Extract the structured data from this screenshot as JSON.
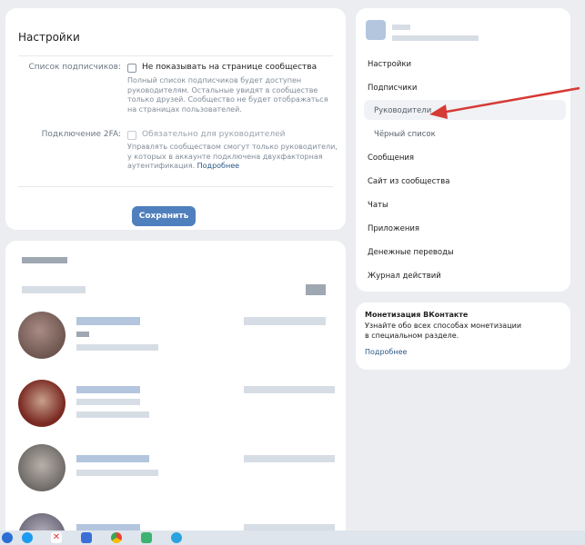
{
  "settings": {
    "title": "Настройки",
    "subscribers_label": "Список подписчиков:",
    "subscribers_checkbox": "Не показывать на странице сообщества",
    "subscribers_hint": [
      "Полный список подписчиков будет доступен",
      "руководителям. Остальные увидят в сообществе",
      "только друзей. Сообщество не будет отображаться",
      "на страницах пользователей."
    ],
    "twofa_label": "Подключение 2FA:",
    "twofa_checkbox": "Обязательно для руководителей",
    "twofa_hint": [
      "Управлять сообществом смогут только руководители,",
      "у которых в аккаунте подключена двухфакторная",
      "аутентификация."
    ],
    "twofa_link": "Подробнее",
    "save_label": "Сохранить"
  },
  "menu": {
    "items": [
      {
        "label": "Настройки"
      },
      {
        "label": "Подписчики"
      },
      {
        "label": "Руководители",
        "selected": true
      },
      {
        "label": "Чёрный список"
      },
      {
        "label": "Сообщения"
      },
      {
        "label": "Сайт из сообщества"
      },
      {
        "label": "Чаты"
      },
      {
        "label": "Приложения"
      },
      {
        "label": "Денежные переводы"
      },
      {
        "label": "Журнал действий"
      }
    ]
  },
  "monetization": {
    "title": "Монетизация ВКонтакте",
    "text": [
      "Узнайте обо всех способах монетизации",
      "в специальном разделе."
    ],
    "link": "Подробнее"
  },
  "colors": {
    "accent": "#4f7fbd",
    "arrow": "#d63a35",
    "link": "#2a5885"
  }
}
